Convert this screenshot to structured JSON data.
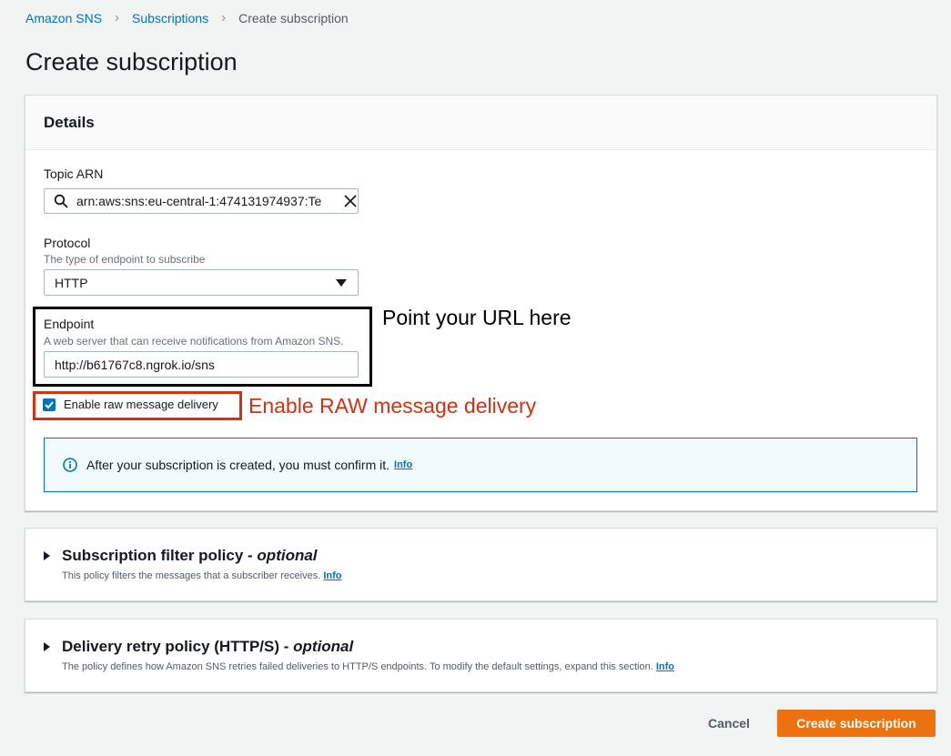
{
  "breadcrumb": {
    "items": [
      "Amazon SNS",
      "Subscriptions"
    ],
    "current": "Create subscription"
  },
  "page_title": "Create subscription",
  "details": {
    "header": "Details",
    "topic_arn": {
      "label": "Topic ARN",
      "value": "arn:aws:sns:eu-central-1:474131974937:Te"
    },
    "protocol": {
      "label": "Protocol",
      "description": "The type of endpoint to subscribe",
      "selected": "HTTP"
    },
    "endpoint": {
      "label": "Endpoint",
      "description": "A web server that can receive notifications from Amazon SNS.",
      "value": "http://b61767c8.ngrok.io/sns"
    },
    "raw_delivery": {
      "label": "Enable raw message delivery",
      "checked": true
    },
    "info_alert": {
      "text": "After your subscription is created, you must confirm it.",
      "link": "Info"
    }
  },
  "annotations": {
    "endpoint_note": "Point your URL here",
    "raw_note": "Enable RAW message delivery",
    "endpoint_note_color": "#000000",
    "raw_note_color": "#d13212"
  },
  "filter_policy": {
    "title": "Subscription filter policy - ",
    "title_optional": "optional",
    "description": "This policy filters the messages that a subscriber receives.",
    "link": "Info"
  },
  "retry_policy": {
    "title": "Delivery retry policy (HTTP/S) - ",
    "title_optional": "optional",
    "description": "The policy defines how Amazon SNS retries failed deliveries to HTTP/S endpoints. To modify the default settings, expand this section.",
    "link": "Info"
  },
  "actions": {
    "cancel": "Cancel",
    "create": "Create subscription"
  },
  "colors": {
    "link": "#0073bb",
    "primary_button": "#ec7211",
    "info_border": "#0073bb",
    "info_bg": "#f1faff",
    "highlight_red": "#d13212"
  },
  "icons": [
    "chevron-right-icon",
    "search-icon",
    "close-icon",
    "caret-down-icon",
    "checkbox-checked-icon",
    "info-icon",
    "caret-right-icon"
  ]
}
